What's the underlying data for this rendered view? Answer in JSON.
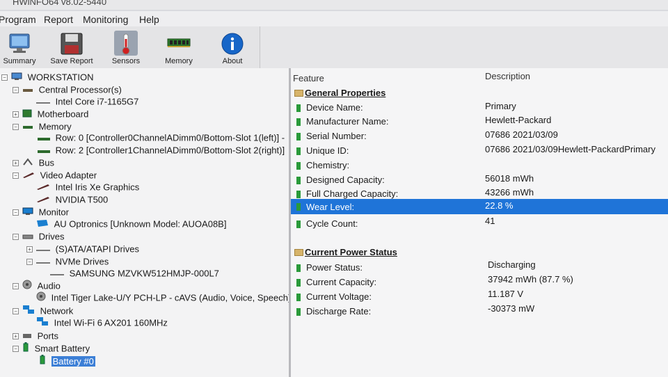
{
  "window": {
    "title": "HWiNFO64 v8.02-5440"
  },
  "menu": [
    "Program",
    "Report",
    "Monitoring",
    "Help"
  ],
  "toolbar": [
    {
      "label": "Summary",
      "icon": "monitor-icon"
    },
    {
      "label": "Save Report",
      "icon": "floppy-disk-icon"
    },
    {
      "label": "Sensors",
      "icon": "thermometer-icon"
    },
    {
      "label": "Memory",
      "icon": "memory-module-icon"
    },
    {
      "label": "About",
      "icon": "info-icon"
    }
  ],
  "tree": {
    "root": "WORKSTATION",
    "cpu": "Central Processor(s)",
    "cpu_item": "Intel Core i7-1165G7",
    "motherboard": "Motherboard",
    "memory": "Memory",
    "mem_row0": "Row: 0 [Controller0ChannelADimm0/Bottom-Slot 1(left)] -",
    "mem_row2": "Row: 2 [Controller1ChannelADimm0/Bottom-Slot 2(right)]",
    "bus": "Bus",
    "video": "Video Adapter",
    "video_item1": "Intel Iris Xe Graphics",
    "video_item2": "NVIDIA T500",
    "monitor": "Monitor",
    "monitor_item": "AU Optronics [Unknown Model: AUOA08B]",
    "drives": "Drives",
    "ata": "(S)ATA/ATAPI Drives",
    "nvme": "NVMe Drives",
    "nvme_item": "SAMSUNG MZVKW512HMJP-000L7",
    "audio": "Audio",
    "audio_item": "Intel Tiger Lake-U/Y PCH-LP - cAVS (Audio, Voice, Speech)",
    "network": "Network",
    "network_item": "Intel Wi-Fi 6 AX201 160MHz",
    "ports": "Ports",
    "battery": "Smart Battery",
    "battery_item": "Battery #0"
  },
  "detail": {
    "col_feature": "Feature",
    "col_description": "Description",
    "section1": "General Properties",
    "section2": "Current Power Status",
    "rows1": [
      {
        "feature": "Device Name:",
        "value": "Primary"
      },
      {
        "feature": "Manufacturer Name:",
        "value": "Hewlett-Packard"
      },
      {
        "feature": "Serial Number:",
        "value": "07686 2021/03/09"
      },
      {
        "feature": "Unique ID:",
        "value": "07686 2021/03/09Hewlett-PackardPrimary"
      },
      {
        "feature": "Chemistry:",
        "value": ""
      },
      {
        "feature": "Designed Capacity:",
        "value": "56018 mWh"
      },
      {
        "feature": "Full Charged Capacity:",
        "value": "43266 mWh"
      },
      {
        "feature": "Wear Level:",
        "value": "22.8 %"
      },
      {
        "feature": "Cycle Count:",
        "value": "41"
      }
    ],
    "rows2": [
      {
        "feature": "Power Status:",
        "value": "Discharging"
      },
      {
        "feature": "Current Capacity:",
        "value": "37942 mWh (87.7 %)"
      },
      {
        "feature": "Current Voltage:",
        "value": "11.187 V"
      },
      {
        "feature": "Discharge Rate:",
        "value": "-30373 mW"
      }
    ]
  },
  "colors": {
    "selection": "#1f74d8",
    "tree_selection": "#3c7fd6",
    "leaf_icon": "#2a9a3a"
  }
}
